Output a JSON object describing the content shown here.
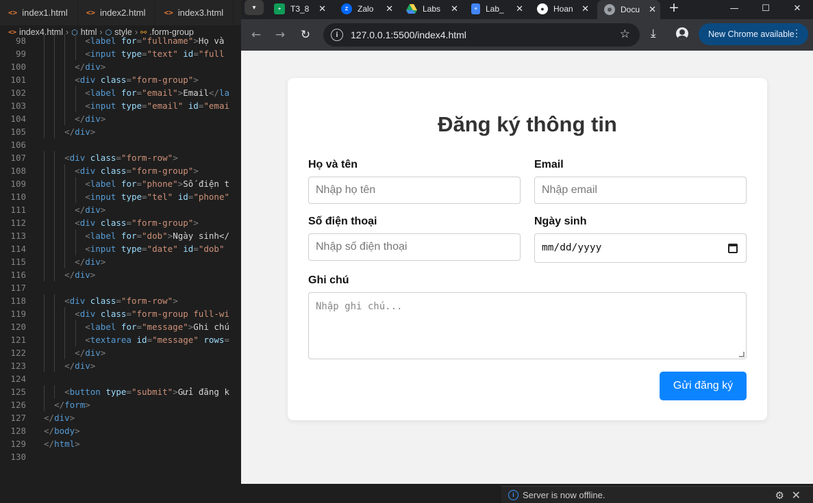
{
  "editor": {
    "tabs": [
      {
        "label": "index1.html"
      },
      {
        "label": "index2.html"
      },
      {
        "label": "index3.html"
      }
    ],
    "breadcrumb": {
      "file": "index4.html",
      "html": "html",
      "style": "style",
      "selector": ".form-group"
    },
    "lines": [
      {
        "n": "98",
        "indent": 5,
        "tokens": [
          [
            "punct",
            "<"
          ],
          [
            "tag",
            "label"
          ],
          [
            "text",
            " "
          ],
          [
            "attr",
            "for"
          ],
          [
            "punct",
            "="
          ],
          [
            "str",
            "\"fullname\""
          ],
          [
            "punct",
            ">"
          ],
          [
            "text",
            "Họ và"
          ]
        ]
      },
      {
        "n": "99",
        "indent": 5,
        "tokens": [
          [
            "punct",
            "<"
          ],
          [
            "tag",
            "input"
          ],
          [
            "text",
            " "
          ],
          [
            "attr",
            "type"
          ],
          [
            "punct",
            "="
          ],
          [
            "str",
            "\"text\""
          ],
          [
            "text",
            " "
          ],
          [
            "attr",
            "id"
          ],
          [
            "punct",
            "="
          ],
          [
            "str",
            "\"full"
          ]
        ]
      },
      {
        "n": "100",
        "indent": 4,
        "tokens": [
          [
            "punct",
            "</"
          ],
          [
            "tag",
            "div"
          ],
          [
            "punct",
            ">"
          ]
        ]
      },
      {
        "n": "101",
        "indent": 4,
        "tokens": [
          [
            "punct",
            "<"
          ],
          [
            "tag",
            "div"
          ],
          [
            "text",
            " "
          ],
          [
            "attr",
            "class"
          ],
          [
            "punct",
            "="
          ],
          [
            "str",
            "\"form-group\""
          ],
          [
            "punct",
            ">"
          ]
        ]
      },
      {
        "n": "102",
        "indent": 5,
        "tokens": [
          [
            "punct",
            "<"
          ],
          [
            "tag",
            "label"
          ],
          [
            "text",
            " "
          ],
          [
            "attr",
            "for"
          ],
          [
            "punct",
            "="
          ],
          [
            "str",
            "\"email\""
          ],
          [
            "punct",
            ">"
          ],
          [
            "text",
            "Email"
          ],
          [
            "punct",
            "</"
          ],
          [
            "tag",
            "la"
          ]
        ]
      },
      {
        "n": "103",
        "indent": 5,
        "tokens": [
          [
            "punct",
            "<"
          ],
          [
            "tag",
            "input"
          ],
          [
            "text",
            " "
          ],
          [
            "attr",
            "type"
          ],
          [
            "punct",
            "="
          ],
          [
            "str",
            "\"email\""
          ],
          [
            "text",
            " "
          ],
          [
            "attr",
            "id"
          ],
          [
            "punct",
            "="
          ],
          [
            "str",
            "\"emai"
          ]
        ]
      },
      {
        "n": "104",
        "indent": 4,
        "tokens": [
          [
            "punct",
            "</"
          ],
          [
            "tag",
            "div"
          ],
          [
            "punct",
            ">"
          ]
        ]
      },
      {
        "n": "105",
        "indent": 3,
        "tokens": [
          [
            "punct",
            "</"
          ],
          [
            "tag",
            "div"
          ],
          [
            "punct",
            ">"
          ]
        ]
      },
      {
        "n": "106",
        "indent": 0,
        "tokens": []
      },
      {
        "n": "107",
        "indent": 3,
        "tokens": [
          [
            "punct",
            "<"
          ],
          [
            "tag",
            "div"
          ],
          [
            "text",
            " "
          ],
          [
            "attr",
            "class"
          ],
          [
            "punct",
            "="
          ],
          [
            "str",
            "\"form-row\""
          ],
          [
            "punct",
            ">"
          ]
        ]
      },
      {
        "n": "108",
        "indent": 4,
        "tokens": [
          [
            "punct",
            "<"
          ],
          [
            "tag",
            "div"
          ],
          [
            "text",
            " "
          ],
          [
            "attr",
            "class"
          ],
          [
            "punct",
            "="
          ],
          [
            "str",
            "\"form-group\""
          ],
          [
            "punct",
            ">"
          ]
        ]
      },
      {
        "n": "109",
        "indent": 5,
        "tokens": [
          [
            "punct",
            "<"
          ],
          [
            "tag",
            "label"
          ],
          [
            "text",
            " "
          ],
          [
            "attr",
            "for"
          ],
          [
            "punct",
            "="
          ],
          [
            "str",
            "\"phone\""
          ],
          [
            "punct",
            ">"
          ],
          [
            "text",
            "Số điện t"
          ]
        ]
      },
      {
        "n": "110",
        "indent": 5,
        "tokens": [
          [
            "punct",
            "<"
          ],
          [
            "tag",
            "input"
          ],
          [
            "text",
            " "
          ],
          [
            "attr",
            "type"
          ],
          [
            "punct",
            "="
          ],
          [
            "str",
            "\"tel\""
          ],
          [
            "text",
            " "
          ],
          [
            "attr",
            "id"
          ],
          [
            "punct",
            "="
          ],
          [
            "str",
            "\"phone\""
          ]
        ]
      },
      {
        "n": "111",
        "indent": 4,
        "tokens": [
          [
            "punct",
            "</"
          ],
          [
            "tag",
            "div"
          ],
          [
            "punct",
            ">"
          ]
        ]
      },
      {
        "n": "112",
        "indent": 4,
        "tokens": [
          [
            "punct",
            "<"
          ],
          [
            "tag",
            "div"
          ],
          [
            "text",
            " "
          ],
          [
            "attr",
            "class"
          ],
          [
            "punct",
            "="
          ],
          [
            "str",
            "\"form-group\""
          ],
          [
            "punct",
            ">"
          ]
        ]
      },
      {
        "n": "113",
        "indent": 5,
        "tokens": [
          [
            "punct",
            "<"
          ],
          [
            "tag",
            "label"
          ],
          [
            "text",
            " "
          ],
          [
            "attr",
            "for"
          ],
          [
            "punct",
            "="
          ],
          [
            "str",
            "\"dob\""
          ],
          [
            "punct",
            ">"
          ],
          [
            "text",
            "Ngày sinh</"
          ]
        ]
      },
      {
        "n": "114",
        "indent": 5,
        "tokens": [
          [
            "punct",
            "<"
          ],
          [
            "tag",
            "input"
          ],
          [
            "text",
            " "
          ],
          [
            "attr",
            "type"
          ],
          [
            "punct",
            "="
          ],
          [
            "str",
            "\"date\""
          ],
          [
            "text",
            " "
          ],
          [
            "attr",
            "id"
          ],
          [
            "punct",
            "="
          ],
          [
            "str",
            "\"dob\""
          ]
        ]
      },
      {
        "n": "115",
        "indent": 4,
        "tokens": [
          [
            "punct",
            "</"
          ],
          [
            "tag",
            "div"
          ],
          [
            "punct",
            ">"
          ]
        ]
      },
      {
        "n": "116",
        "indent": 3,
        "tokens": [
          [
            "punct",
            "</"
          ],
          [
            "tag",
            "div"
          ],
          [
            "punct",
            ">"
          ]
        ]
      },
      {
        "n": "117",
        "indent": 0,
        "tokens": []
      },
      {
        "n": "118",
        "indent": 3,
        "tokens": [
          [
            "punct",
            "<"
          ],
          [
            "tag",
            "div"
          ],
          [
            "text",
            " "
          ],
          [
            "attr",
            "class"
          ],
          [
            "punct",
            "="
          ],
          [
            "str",
            "\"form-row\""
          ],
          [
            "punct",
            ">"
          ]
        ]
      },
      {
        "n": "119",
        "indent": 4,
        "tokens": [
          [
            "punct",
            "<"
          ],
          [
            "tag",
            "div"
          ],
          [
            "text",
            " "
          ],
          [
            "attr",
            "class"
          ],
          [
            "punct",
            "="
          ],
          [
            "str",
            "\"form-group full-wi"
          ]
        ]
      },
      {
        "n": "120",
        "indent": 5,
        "tokens": [
          [
            "punct",
            "<"
          ],
          [
            "tag",
            "label"
          ],
          [
            "text",
            " "
          ],
          [
            "attr",
            "for"
          ],
          [
            "punct",
            "="
          ],
          [
            "str",
            "\"message\""
          ],
          [
            "punct",
            ">"
          ],
          [
            "text",
            "Ghi chú"
          ]
        ]
      },
      {
        "n": "121",
        "indent": 5,
        "tokens": [
          [
            "punct",
            "<"
          ],
          [
            "tag",
            "textarea"
          ],
          [
            "text",
            " "
          ],
          [
            "attr",
            "id"
          ],
          [
            "punct",
            "="
          ],
          [
            "str",
            "\"message\""
          ],
          [
            "text",
            " "
          ],
          [
            "attr",
            "rows"
          ],
          [
            "punct",
            "="
          ]
        ]
      },
      {
        "n": "122",
        "indent": 4,
        "tokens": [
          [
            "punct",
            "</"
          ],
          [
            "tag",
            "div"
          ],
          [
            "punct",
            ">"
          ]
        ]
      },
      {
        "n": "123",
        "indent": 3,
        "tokens": [
          [
            "punct",
            "</"
          ],
          [
            "tag",
            "div"
          ],
          [
            "punct",
            ">"
          ]
        ]
      },
      {
        "n": "124",
        "indent": 0,
        "tokens": []
      },
      {
        "n": "125",
        "indent": 3,
        "tokens": [
          [
            "punct",
            "<"
          ],
          [
            "tag",
            "button"
          ],
          [
            "text",
            " "
          ],
          [
            "attr",
            "type"
          ],
          [
            "punct",
            "="
          ],
          [
            "str",
            "\"submit\""
          ],
          [
            "punct",
            ">"
          ],
          [
            "text",
            "Gửi đăng k"
          ]
        ]
      },
      {
        "n": "126",
        "indent": 2,
        "tokens": [
          [
            "punct",
            "</"
          ],
          [
            "tag",
            "form"
          ],
          [
            "punct",
            ">"
          ]
        ]
      },
      {
        "n": "127",
        "indent": 1,
        "tokens": [
          [
            "punct",
            "</"
          ],
          [
            "tag",
            "div"
          ],
          [
            "punct",
            ">"
          ]
        ]
      },
      {
        "n": "128",
        "indent": 0,
        "tokens": [
          [
            "punct",
            "</"
          ],
          [
            "tag",
            "body"
          ],
          [
            "punct",
            ">"
          ]
        ]
      },
      {
        "n": "129",
        "indent": 0,
        "tokens": [
          [
            "punct",
            "</"
          ],
          [
            "tag",
            "html"
          ],
          [
            "punct",
            ">"
          ]
        ]
      },
      {
        "n": "130",
        "indent": 0,
        "tokens": []
      }
    ]
  },
  "browser": {
    "tabs": [
      {
        "label": "T3_8",
        "icon": "sheets-icon",
        "color": "#0f9d58"
      },
      {
        "label": "Zalo",
        "icon": "zalo-icon",
        "color": "#0068ff"
      },
      {
        "label": "Labs",
        "icon": "drive-icon",
        "color": "#fbbc04"
      },
      {
        "label": "Lab_",
        "icon": "docs-icon",
        "color": "#4285f4"
      },
      {
        "label": "Hoan",
        "icon": "github-icon",
        "color": "#ffffff"
      },
      {
        "label": "Docu",
        "icon": "globe-icon",
        "color": "#9aa0a6"
      }
    ],
    "url": "127.0.0.1:5500/index4.html",
    "update_label": "New Chrome available"
  },
  "page": {
    "title": "Đăng ký thông tin",
    "fields": {
      "fullname": {
        "label": "Họ và tên",
        "placeholder": "Nhập họ tên"
      },
      "email": {
        "label": "Email",
        "placeholder": "Nhập email"
      },
      "phone": {
        "label": "Số điện thoại",
        "placeholder": "Nhập số điện thoại"
      },
      "dob": {
        "label": "Ngày sinh",
        "placeholder": "mm/dd/yyyy"
      },
      "message": {
        "label": "Ghi chú",
        "placeholder": "Nhập ghi chú..."
      }
    },
    "submit_label": "Gửi đăng ký",
    "accent": "#0a84ff"
  },
  "status": {
    "message": "Server is now offline."
  }
}
